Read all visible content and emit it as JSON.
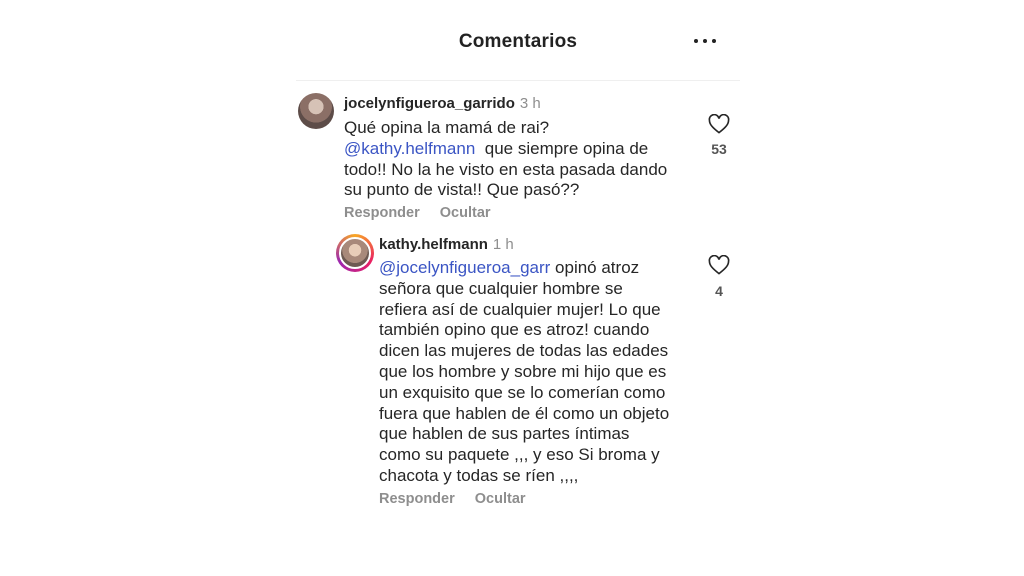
{
  "header": {
    "title": "Comentarios",
    "more_icon": "more-horizontal-icon"
  },
  "comments": [
    {
      "username": "jocelynfigueroa_garrido",
      "time": "3 h",
      "mention": "@kathy.helfmann",
      "lines": [
        "Qué opina la mamá de rai?",
        "que siempre opina de",
        "todo!! No la he visto en esta pasada dando",
        "su punto de vista!! Que pasó??"
      ],
      "actions": {
        "reply": "Responder",
        "hide": "Ocultar"
      },
      "likes": "53",
      "like_icon": "heart-outline-icon"
    },
    {
      "username": "kathy.helfmann",
      "time": "1 h",
      "mention": "@jocelynfigueroa_garr",
      "lines": [
        "opinó atroz",
        "señora que cualquier hombre se",
        "refiera así de cualquier mujer! Lo que",
        "también opino que es atroz!  cuando",
        "dicen las mujeres de todas las edades",
        "que los hombre y sobre mi hijo que es",
        "un exquisito que se lo comerían como",
        "fuera que hablen de él como un objeto",
        "que hablen de sus partes íntimas",
        "como su paquete ,,, y eso Si  broma y",
        "chacota y todas se ríen ,,,,"
      ],
      "actions": {
        "reply": "Responder",
        "hide": "Ocultar"
      },
      "likes": "4",
      "like_icon": "heart-outline-icon",
      "avatar_ring": "story-ring"
    }
  ]
}
